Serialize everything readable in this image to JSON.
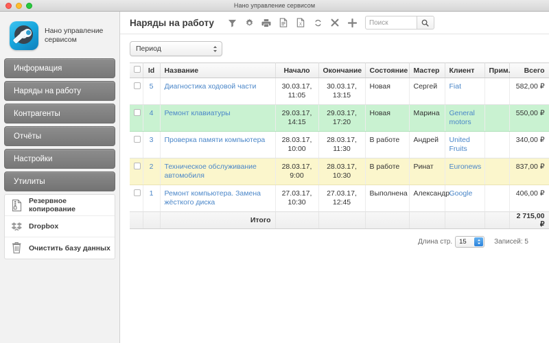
{
  "window": {
    "title": "Нано управление сервисом",
    "traffic_lights": [
      "close",
      "minimize",
      "zoom"
    ]
  },
  "sidebar": {
    "brand": {
      "name": "Нано управление сервисом",
      "icon": "wrench-gear-app-icon"
    },
    "nav": [
      {
        "label": "Информация",
        "name": "informaciya"
      },
      {
        "label": "Наряды на работу",
        "name": "naryady-na-rabotu"
      },
      {
        "label": "Контрагенты",
        "name": "kontragenty"
      },
      {
        "label": "Отчёты",
        "name": "otchety"
      },
      {
        "label": "Настройки",
        "name": "nastroyki"
      },
      {
        "label": "Утилиты",
        "name": "utility"
      }
    ],
    "utilities": [
      {
        "label": "Резервное копирование",
        "icon": "archive-file-icon"
      },
      {
        "label": "Dropbox",
        "icon": "dropbox-icon"
      },
      {
        "label": "Очистить базу данных",
        "icon": "trash-icon"
      }
    ]
  },
  "toolbar": {
    "page_title": "Наряды на работу",
    "icons": [
      {
        "name": "filter-icon",
        "title": "Фильтр"
      },
      {
        "name": "gear-icon",
        "title": "Настройки"
      },
      {
        "name": "printer-icon",
        "title": "Печать"
      },
      {
        "name": "document-icon",
        "title": "Документ"
      },
      {
        "name": "excel-document-icon",
        "title": "Excel"
      },
      {
        "name": "refresh-icon",
        "title": "Обновить"
      },
      {
        "name": "close-icon",
        "title": "Удалить"
      },
      {
        "name": "plus-icon",
        "title": "Добавить"
      }
    ],
    "search": {
      "value": "",
      "placeholder": "Поиск",
      "button_icon": "search-icon"
    }
  },
  "filters": {
    "period": {
      "label": "Период",
      "icon": "updown-stepper-icon"
    }
  },
  "table": {
    "columns": [
      "",
      "Id",
      "Название",
      "Начало",
      "Окончание",
      "Состояние",
      "Мастер",
      "Клиент",
      "Прим.",
      "Всего",
      ""
    ],
    "rows": [
      {
        "id": "5",
        "name": "Диагностика ходовой части",
        "start": "30.03.17, 11:05",
        "end": "30.03.17, 13:15",
        "state": "Новая",
        "master": "Сергей",
        "client": "Fiat",
        "note": "",
        "total": "582,00 ₽",
        "highlight": "white"
      },
      {
        "id": "4",
        "name": "Ремонт клавиатуры",
        "start": "29.03.17, 14:15",
        "end": "29.03.17, 17:20",
        "state": "Новая",
        "master": "Марина",
        "client": "General motors",
        "note": "",
        "total": "550,00 ₽",
        "highlight": "green"
      },
      {
        "id": "3",
        "name": "Проверка памяти компьютера",
        "start": "28.03.17, 10:00",
        "end": "28.03.17, 11:30",
        "state": "В работе",
        "master": "Андрей",
        "client": "United Fruits",
        "note": "",
        "total": "340,00 ₽",
        "highlight": "white"
      },
      {
        "id": "2",
        "name": "Техническое обслуживание автомобиля",
        "start": "28.03.17, 9:00",
        "end": "28.03.17, 10:30",
        "state": "В работе",
        "master": "Ринат",
        "client": "Euronews",
        "note": "",
        "total": "837,00 ₽",
        "highlight": "yellow"
      },
      {
        "id": "1",
        "name": "Ремонт компьютера. Замена жёсткого диска",
        "start": "27.03.17, 10:30",
        "end": "27.03.17, 12:45",
        "state": "Выполнена",
        "master": "Александр",
        "client": "Google",
        "note": "",
        "total": "406,00 ₽",
        "highlight": "white"
      }
    ],
    "footer": {
      "label": "Итого",
      "total": "2 715,00 ₽"
    }
  },
  "pagination": {
    "page_length_label": "Длина стр.",
    "page_length_value": "15",
    "records_label": "Записей: 5"
  },
  "colors": {
    "link": "#4a86c8",
    "row_green": "#c9f2d1",
    "row_yellow": "#fbf6cc",
    "nav_button": "#7d7d7d",
    "accent_blue": "#2a82dc"
  }
}
